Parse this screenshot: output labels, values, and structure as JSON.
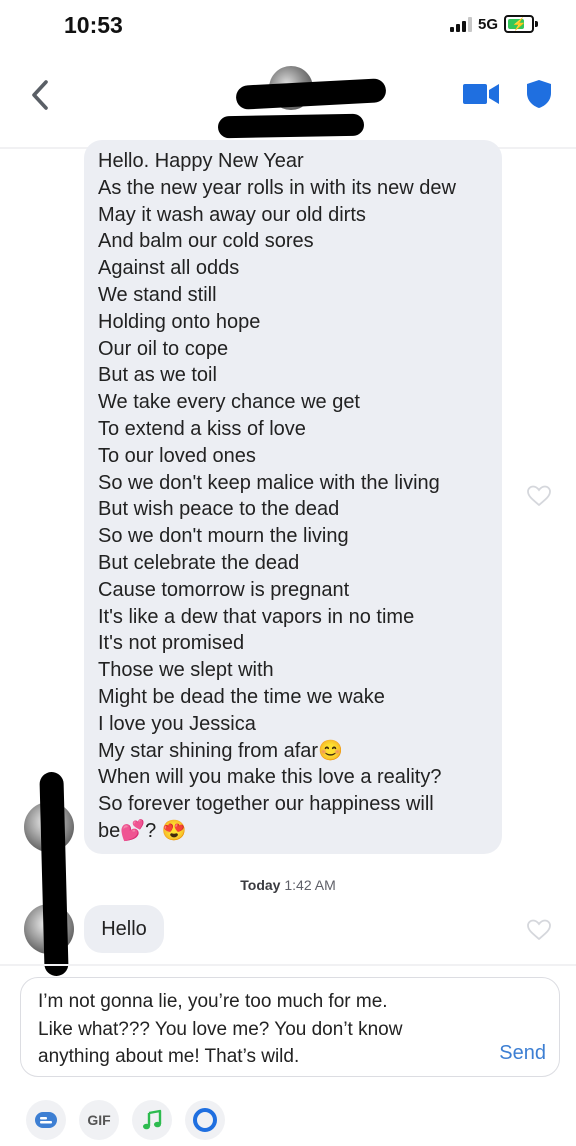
{
  "status_bar": {
    "time": "10:53",
    "network": "5G",
    "signal_bars_filled": 3,
    "signal_bars_total": 4,
    "battery_state": "charging"
  },
  "header": {
    "back_icon": "chevron-left-icon",
    "video_icon": "video-camera-icon",
    "shield_icon": "shield-icon",
    "accent_color": "#1f6fe0"
  },
  "messages": [
    {
      "sender": "other",
      "lines": [
        "Hello. Happy New Year",
        "As the new year rolls in with its new dew",
        "May it wash away our old dirts",
        "And balm our cold sores",
        "Against all odds",
        "We stand still",
        "Holding onto hope",
        "Our oil to cope",
        "But as we toil",
        "We take every chance we get",
        "To extend a kiss of love",
        "To our loved ones",
        "So we don't keep malice with the living",
        "But wish peace to the dead",
        "So we don't mourn the living",
        "But celebrate the dead",
        "Cause tomorrow is pregnant",
        "It's like a dew that vapors in no time",
        "It's not promised",
        "Those we slept with",
        "Might be dead the time we wake",
        "I love you Jessica",
        "My star shining from afar😊",
        "When will you make this love a reality?",
        "So forever together our happiness will",
        "be💕? 😍"
      ],
      "liked": false
    },
    {
      "sender": "other",
      "text": "Hello",
      "liked": false
    }
  ],
  "timestamp": {
    "day": "Today",
    "time": "1:42 AM"
  },
  "composer": {
    "lines": [
      "I’m not gonna lie, you’re too much for me.",
      "Like what??? You love me? You don’t know",
      "anything about me! That’s wild."
    ],
    "send_label": "Send",
    "send_color": "#3d7fd3"
  },
  "toolbar": {
    "gif_label": "GIF",
    "items": [
      "sticker-icon",
      "gif-button",
      "music-note-icon",
      "ring-icon"
    ]
  }
}
